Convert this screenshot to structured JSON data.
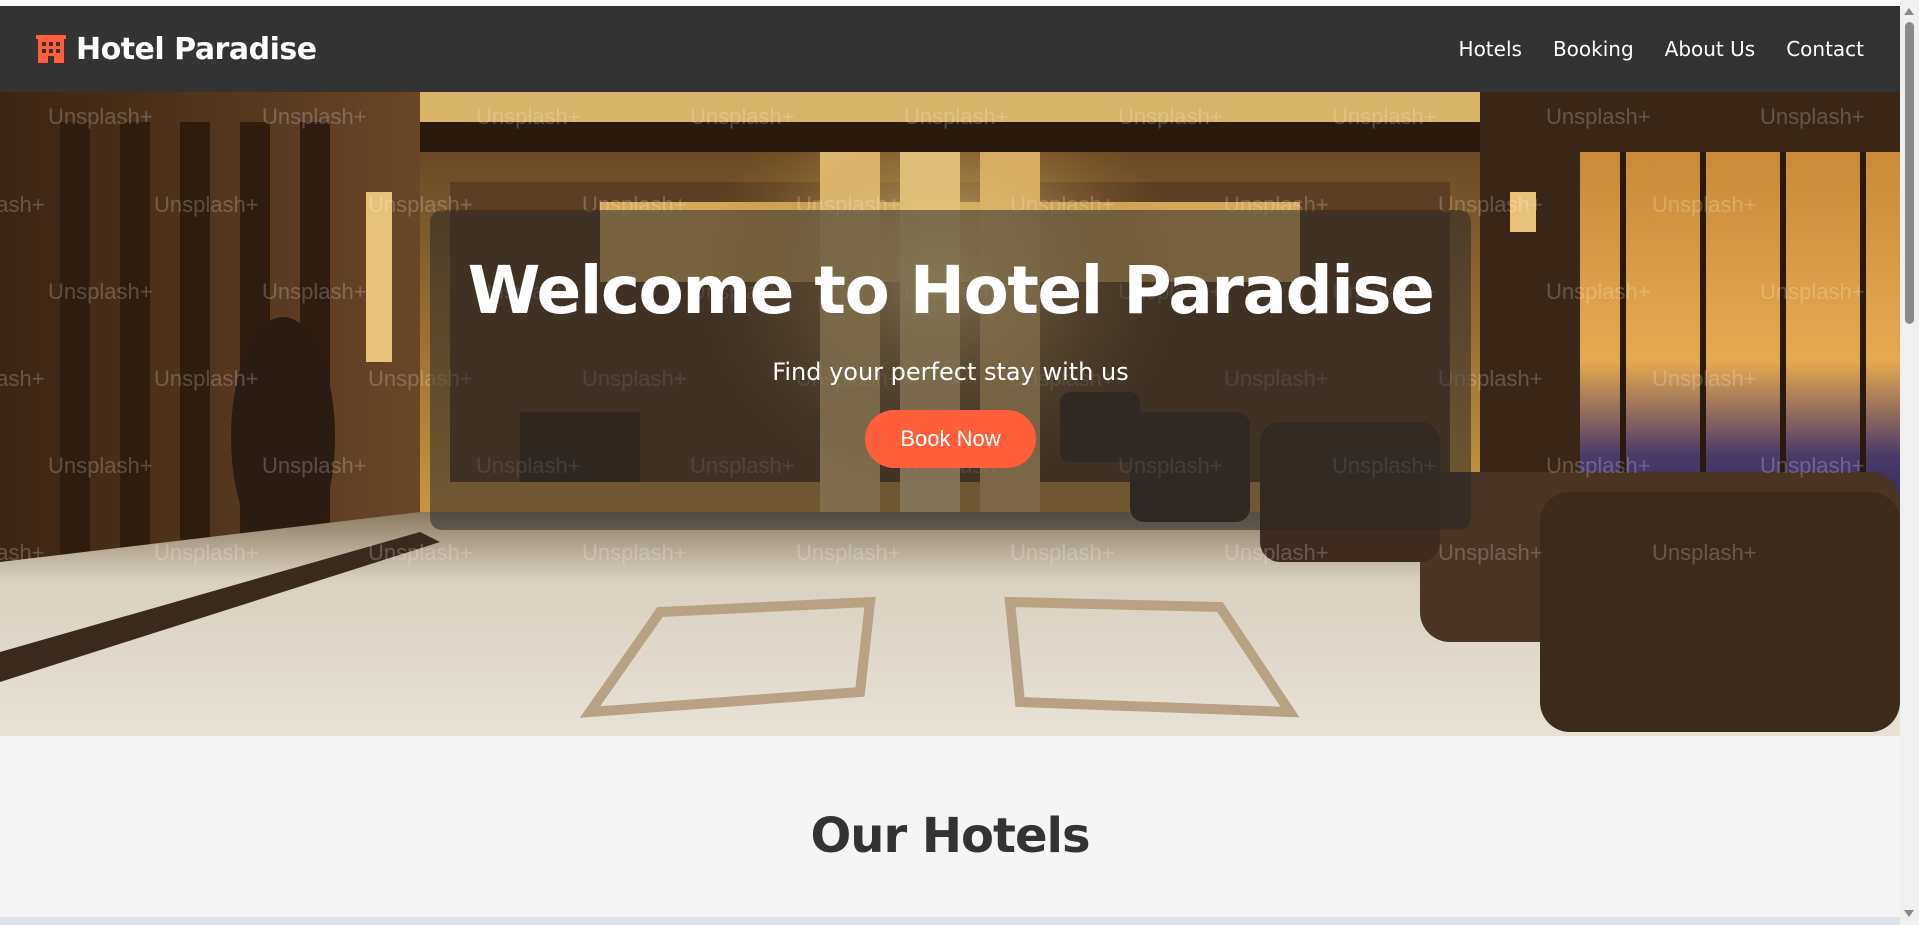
{
  "header": {
    "brand_name": "Hotel Paradise",
    "brand_icon": "building-icon",
    "nav": [
      {
        "label": "Hotels"
      },
      {
        "label": "Booking"
      },
      {
        "label": "About Us"
      },
      {
        "label": "Contact"
      }
    ]
  },
  "hero": {
    "title": "Welcome to Hotel Paradise",
    "subtitle": "Find your perfect stay with us",
    "cta_label": "Book Now",
    "watermark": "Unsplash+"
  },
  "hotels_section": {
    "title": "Our Hotels"
  },
  "colors": {
    "navbar": "#333333",
    "accent": "#ff5e3a",
    "page_bg": "#f5f5f5",
    "heading": "#333333"
  }
}
